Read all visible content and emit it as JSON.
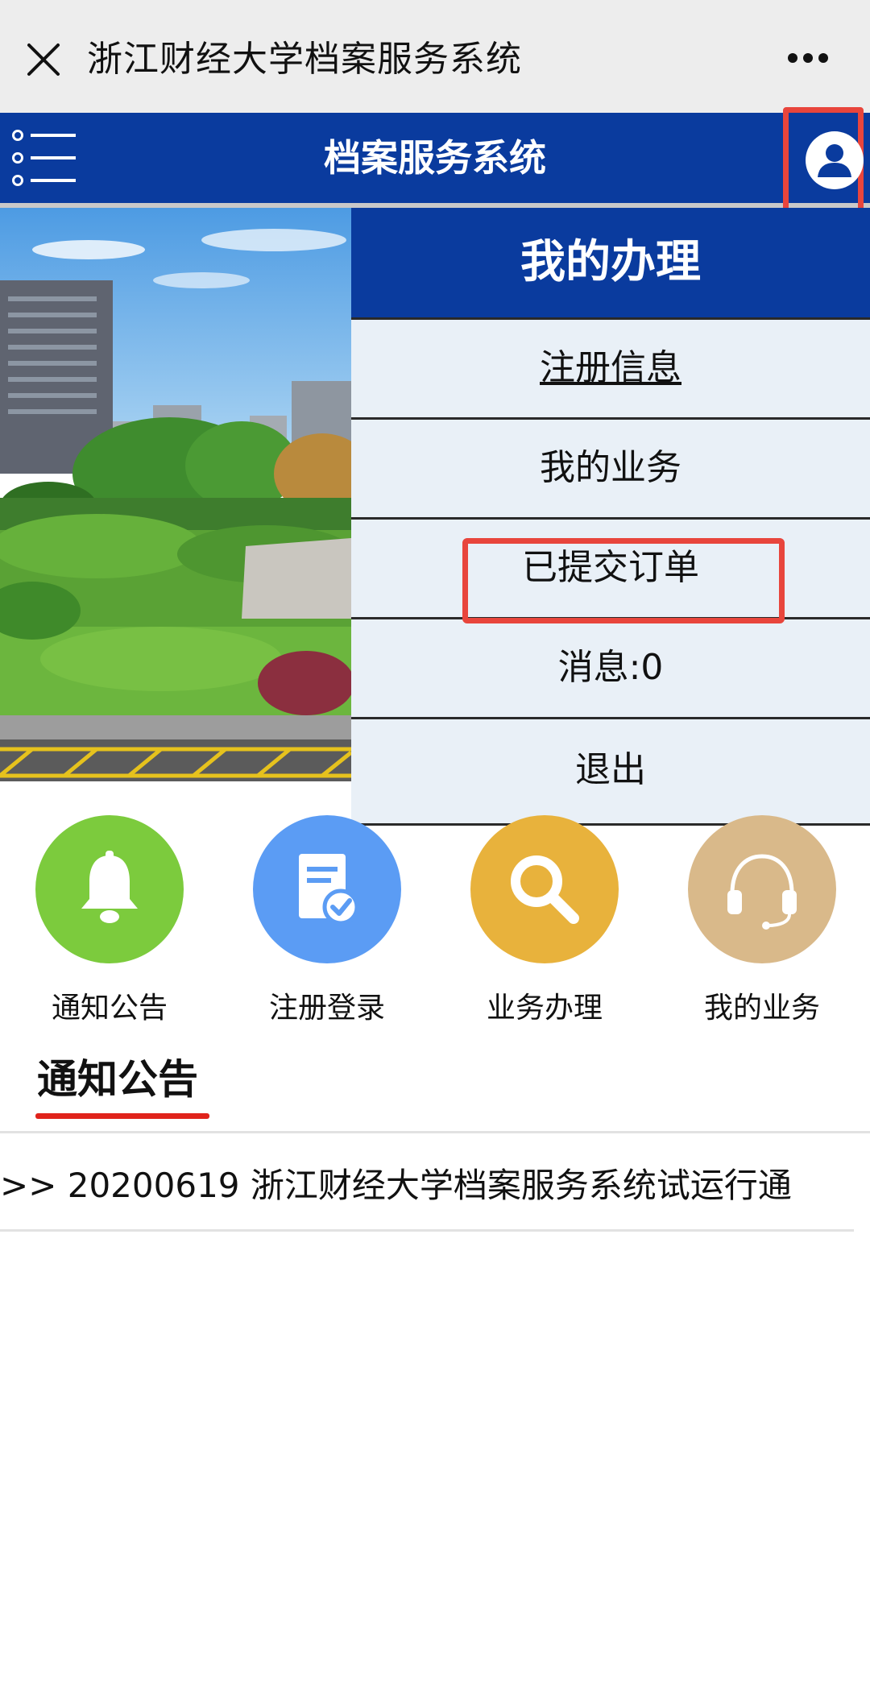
{
  "wechat": {
    "title": "浙江财经大学档案服务系统"
  },
  "app": {
    "title": "档案服务系统"
  },
  "dropdown": {
    "heading": "我的办理",
    "items": [
      {
        "label": "注册信息"
      },
      {
        "label": "我的业务"
      },
      {
        "label": "已提交订单"
      },
      {
        "label": "消息:0"
      },
      {
        "label": "退出"
      }
    ]
  },
  "quick_links": [
    {
      "label": "通知公告",
      "icon": "bell-icon",
      "color": "#7ccb3d"
    },
    {
      "label": "注册登录",
      "icon": "document-check-icon",
      "color": "#5b9cf4"
    },
    {
      "label": "业务办理",
      "icon": "search-icon",
      "color": "#e8b23c"
    },
    {
      "label": "我的业务",
      "icon": "headset-icon",
      "color": "#d9b98a"
    }
  ],
  "notices": {
    "heading": "通知公告",
    "items": [
      {
        "text": ">> 20200619  浙江财经大学档案服务系统试运行通"
      }
    ]
  },
  "colors": {
    "header_blue": "#0a3b9e",
    "highlight_red": "#e8453c",
    "notice_underline": "#e0231b"
  }
}
